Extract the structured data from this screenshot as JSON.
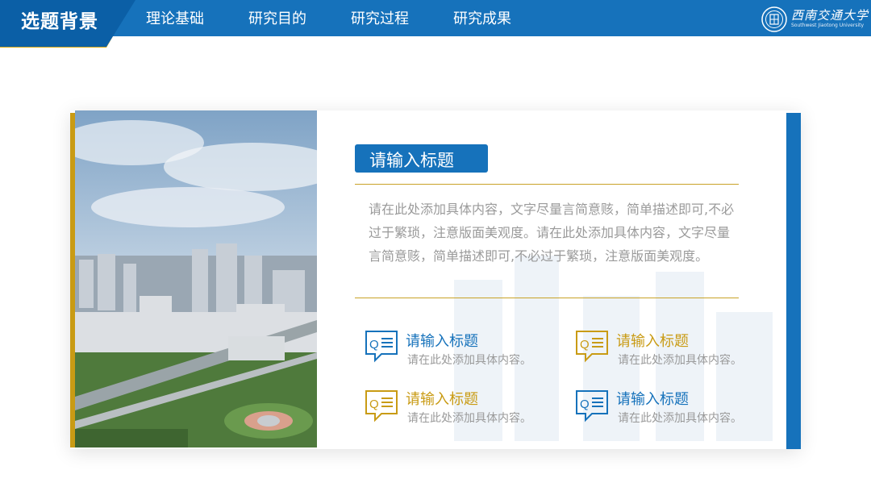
{
  "header": {
    "section_title": "选题背景",
    "nav": [
      "理论基础",
      "研究目的",
      "研究过程",
      "研究成果"
    ],
    "logo_text": "西南交通大学",
    "logo_sub": "Southwest Jiaotong University"
  },
  "card": {
    "title": "请输入标题",
    "body": "请在此处添加具体内容，文字尽量言简意赅，简单描述即可,不必过于繁琐，注意版面美观度。请在此处添加具体内容，文字尽量言简意赅，简单描述即可,不必过于繁琐，注意版面美观度。",
    "items": [
      {
        "title": "请输入标题",
        "desc": "请在此处添加具体内容。",
        "color": "#1672bb"
      },
      {
        "title": "请输入标题",
        "desc": "请在此处添加具体内容。",
        "color": "#c99b14"
      },
      {
        "title": "请输入标题",
        "desc": "请在此处添加具体内容。",
        "color": "#c99b14"
      },
      {
        "title": "请输入标题",
        "desc": "请在此处添加具体内容。",
        "color": "#1672bb"
      }
    ]
  },
  "colors": {
    "primary": "#1672bb",
    "accent": "#c99b14"
  }
}
